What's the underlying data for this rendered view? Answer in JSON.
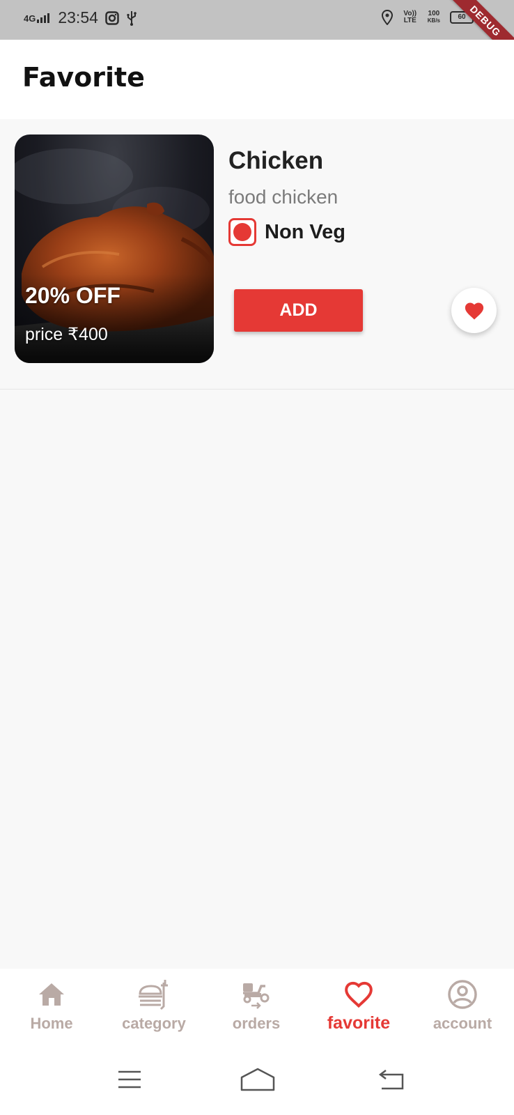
{
  "status_bar": {
    "network": "4G",
    "time": "23:54",
    "volte": "Vo)) LTE",
    "speed_value": "100",
    "speed_unit": "KB/s",
    "battery": "60"
  },
  "debug_banner": "DEBUG",
  "app_bar": {
    "title": "Favorite"
  },
  "favorites": [
    {
      "discount": "20% OFF",
      "price": "price ₹400",
      "name": "Chicken",
      "description": "food chicken",
      "type": "Non Veg",
      "add_label": "ADD",
      "is_favorite": true
    }
  ],
  "bottom_nav": {
    "items": [
      {
        "label": "Home",
        "icon": "home-icon",
        "active": false
      },
      {
        "label": "category",
        "icon": "food-tray-icon",
        "active": false
      },
      {
        "label": "orders",
        "icon": "delivery-scooter-icon",
        "active": false
      },
      {
        "label": "favorite",
        "icon": "heart-outline-icon",
        "active": true
      },
      {
        "label": "account",
        "icon": "account-circle-icon",
        "active": false
      }
    ]
  },
  "colors": {
    "accent": "#e53935",
    "inactive_nav": "#b9aaa5",
    "background": "#f8f8f8",
    "status_bar": "#c2c2c2"
  }
}
